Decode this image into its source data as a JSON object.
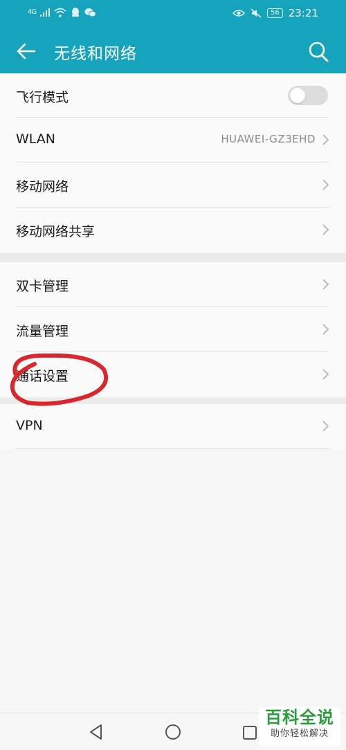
{
  "status_bar": {
    "network_label": "4G",
    "battery": "56",
    "time": "23:21",
    "icons": [
      "signal-icon",
      "wifi-icon",
      "qq-icon",
      "wechat-icon",
      "eye-comfort-icon",
      "mute-icon",
      "battery-icon"
    ]
  },
  "header": {
    "title": "无线和网络",
    "back_icon": "arrow-left-icon",
    "search_icon": "search-icon",
    "background_color": "#16a4bd"
  },
  "group1": {
    "items": [
      {
        "label": "飞行模式",
        "control": "toggle",
        "toggle_on": false
      },
      {
        "label": "WLAN",
        "value": "HUAWEI-GZ3EHD",
        "control": "chevron"
      },
      {
        "label": "移动网络",
        "control": "chevron"
      },
      {
        "label": "移动网络共享",
        "control": "chevron"
      }
    ]
  },
  "group2": {
    "items": [
      {
        "label": "双卡管理",
        "control": "chevron"
      },
      {
        "label": "流量管理",
        "control": "chevron"
      },
      {
        "label": "通话设置",
        "control": "chevron"
      }
    ]
  },
  "group3": {
    "items": [
      {
        "label": "VPN",
        "control": "chevron"
      }
    ]
  },
  "annotation": {
    "shape": "red-circle",
    "color": "#d9272e",
    "target": "通话设置"
  },
  "navbar": {
    "icons": [
      "nav-back-icon",
      "nav-home-icon",
      "nav-recent-icon"
    ]
  },
  "watermark": {
    "title": "百科全说",
    "subtitle": "助你轻松解决"
  }
}
